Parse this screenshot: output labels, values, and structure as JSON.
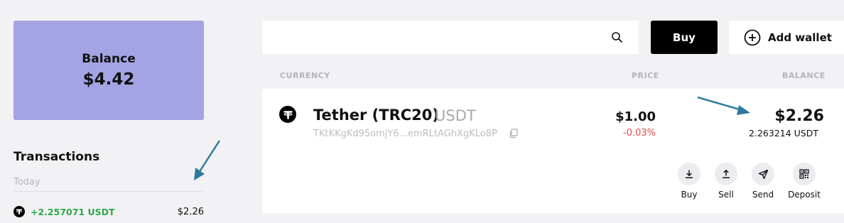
{
  "balance": {
    "label": "Balance",
    "value": "$4.42"
  },
  "transactions": {
    "title": "Transactions",
    "day": "Today",
    "items": [
      {
        "icon": "tether-icon",
        "amount": "+2.257071 USDT",
        "usd": "$2.26"
      }
    ]
  },
  "search": {
    "placeholder": "",
    "icon": "search-icon"
  },
  "buttons": {
    "buy": "Buy",
    "add_wallet": "Add wallet"
  },
  "columns": {
    "currency": "CURRENCY",
    "price": "PRICE",
    "balance": "BALANCE"
  },
  "wallet": {
    "icon": "tether-icon",
    "name": "Tether (TRC20)",
    "ticker": "USDT",
    "address": "TKtKKgKd95omjY6...emRLtAGhXgKLo8P",
    "price": "$1.00",
    "change": "-0.03%",
    "balance_usd": "$2.26",
    "balance_token": "2.263214 USDT",
    "actions": [
      {
        "label": "Buy",
        "icon": "download-icon"
      },
      {
        "label": "Sell",
        "icon": "upload-icon"
      },
      {
        "label": "Send",
        "icon": "send-icon"
      },
      {
        "label": "Deposit",
        "icon": "qr-code-icon"
      }
    ]
  },
  "colors": {
    "balance_card": "#a4a4e4",
    "positive": "#2ea84a",
    "negative": "#e5484d",
    "annotation_arrow": "#2f7aa0"
  }
}
